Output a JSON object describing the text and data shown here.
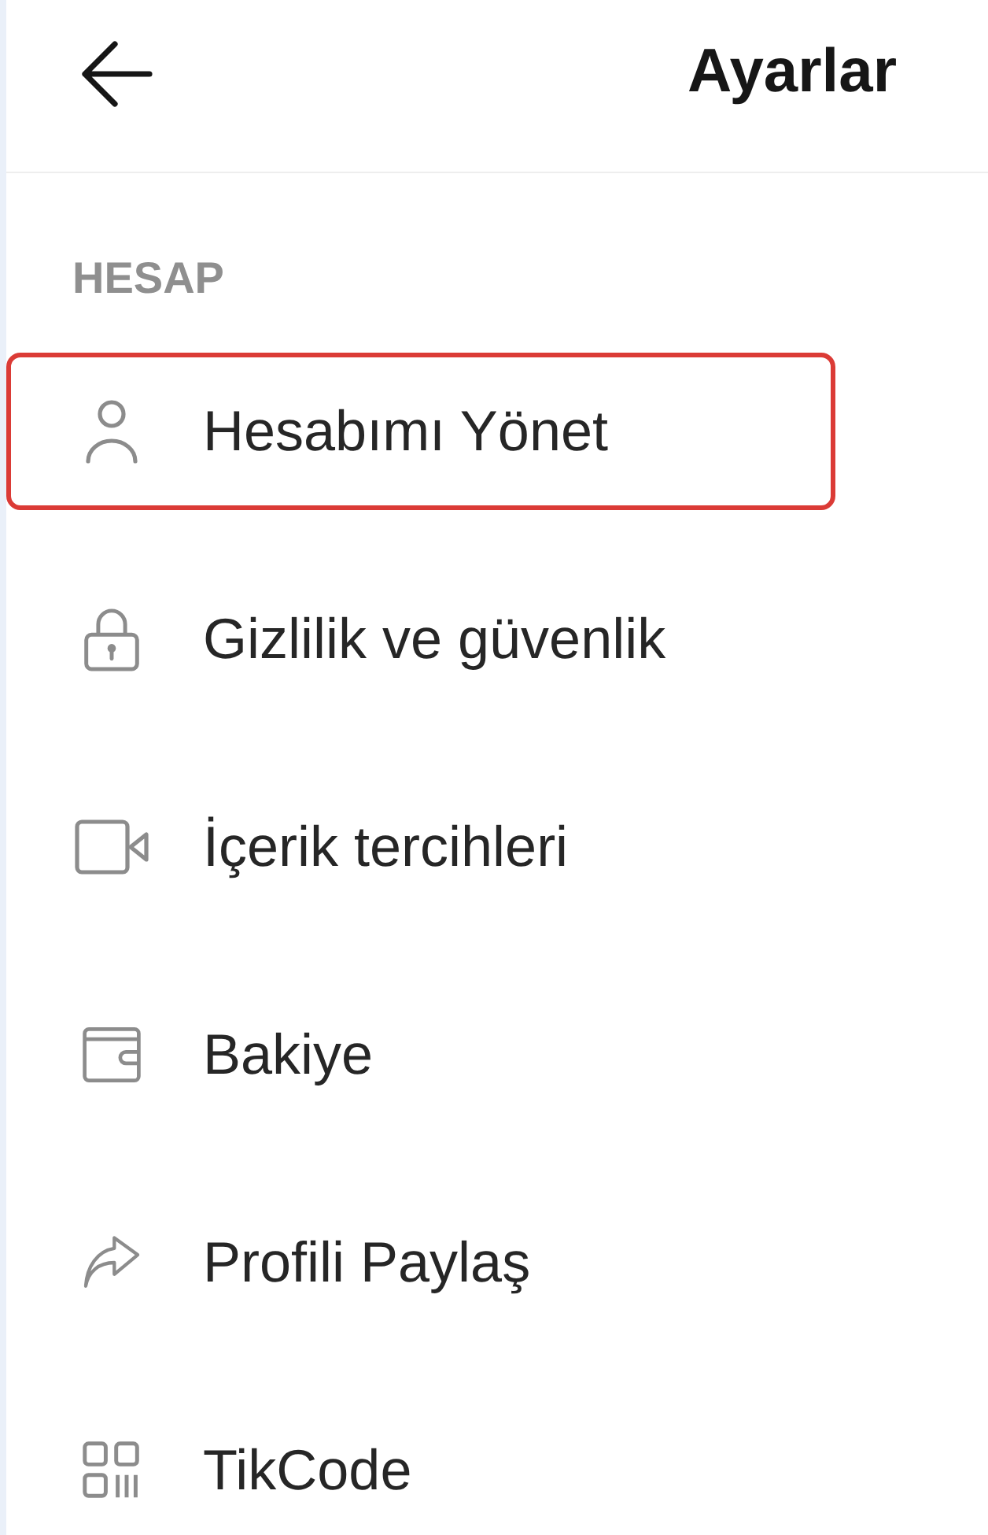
{
  "header": {
    "title": "Ayarlar"
  },
  "section": {
    "label": "HESAP"
  },
  "items": [
    {
      "label": "Hesabımı Yönet",
      "highlighted": true
    },
    {
      "label": "Gizlilik ve güvenlik",
      "highlighted": false
    },
    {
      "label": "İçerik tercihleri",
      "highlighted": false
    },
    {
      "label": "Bakiye",
      "highlighted": false
    },
    {
      "label": "Profili Paylaş",
      "highlighted": false
    },
    {
      "label": "TikCode",
      "highlighted": false
    }
  ]
}
